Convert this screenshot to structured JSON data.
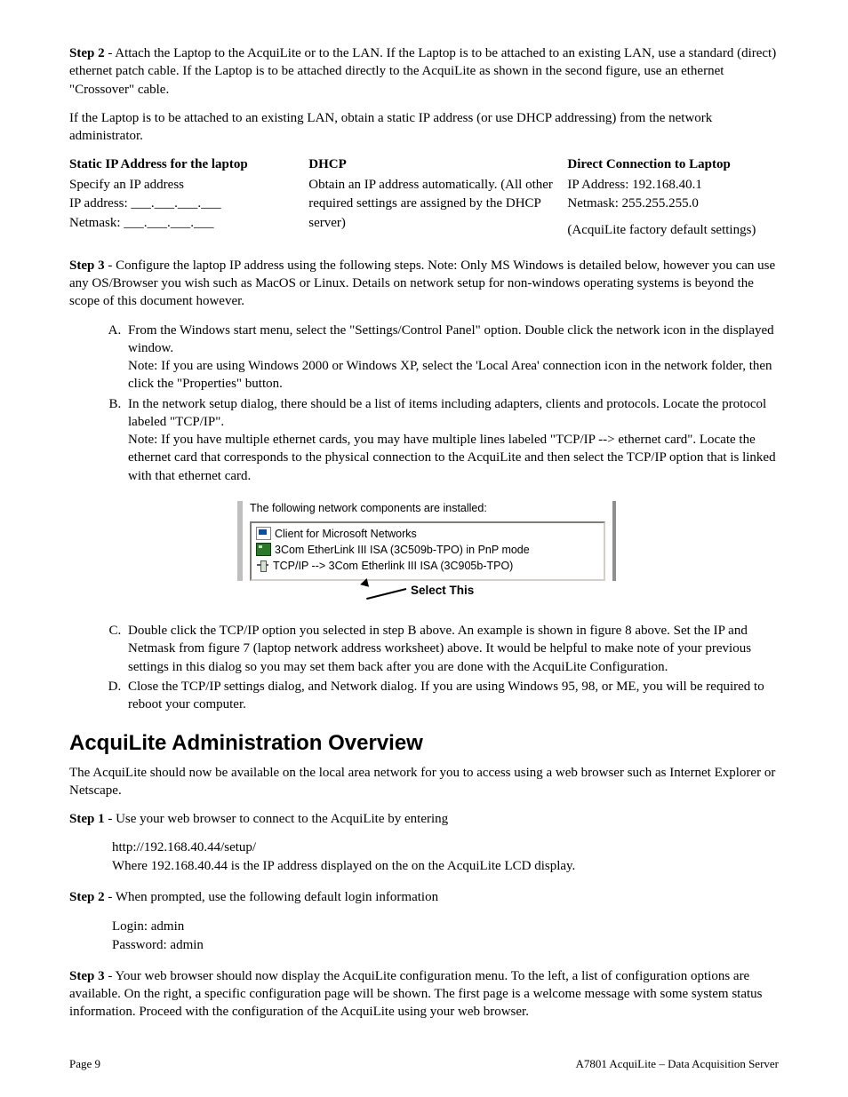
{
  "step2": {
    "label": "Step 2",
    "text1": " - Attach the Laptop to the AcquiLite or to the LAN. If the Laptop is to be attached to an existing LAN, use a standard (direct) ethernet patch cable. If the Laptop is to be attached directly to the AcquiLite as shown in the second figure, use an ethernet \"Crossover\" cable.",
    "text2": "If the Laptop is to be attached to an existing LAN, obtain a static IP address (or use DHCP addressing) from the network administrator."
  },
  "ipTable": {
    "col1": {
      "head": "Static IP Address for the laptop",
      "l1": "Specify an IP address",
      "l2": "IP address: ___.___.___.___",
      "l3": "Netmask: ___.___.___.___"
    },
    "col2": {
      "head": "DHCP",
      "l1": "Obtain an IP address automatically. (All other required settings are assigned by the DHCP server)"
    },
    "col3": {
      "head": "Direct Connection to Laptop",
      "l1": "IP Address: 192.168.40.1",
      "l2": "Netmask: 255.255.255.0",
      "l3": "(AcquiLite factory default settings)"
    }
  },
  "step3": {
    "label": "Step 3",
    "intro": " - Configure the laptop IP address using the following steps. Note: Only MS Windows is detailed below, however you can use any OS/Browser you wish such as MacOS or Linux. Details on network setup for non-windows operating systems is beyond the scope of this document however.",
    "A": "From the Windows start menu, select the \"Settings/Control Panel\" option. Double click the network icon in the displayed window.\nNote: If you are using Windows 2000 or Windows XP, select the 'Local Area' connection icon in the network folder, then click the \"Properties\" button.",
    "B": "In the network setup dialog, there should be a list of items including adapters, clients and protocols. Locate the protocol labeled \"TCP/IP\".\nNote: If you have multiple ethernet cards, you may have multiple lines labeled \"TCP/IP --> ethernet card\". Locate the ethernet card that corresponds to the physical connection to the AcquiLite and then select the TCP/IP option that is linked with that ethernet card.",
    "C": "Double click the TCP/IP option you selected in step B above. An example is shown in figure 8 above. Set the IP and Netmask from figure 7 (laptop network address worksheet) above. It would be helpful to make note of your previous settings in this dialog so you may set them back after you are done with the AcquiLite Configuration.",
    "D": "Close the TCP/IP settings dialog, and Network dialog. If you are using Windows 95, 98, or ME, you will be required to reboot your computer."
  },
  "dialog": {
    "caption": "The following network components are installed:",
    "item1": "Client for Microsoft Networks",
    "item2": "3Com EtherLink III ISA (3C509b-TPO) in PnP mode",
    "item3": "TCP/IP --> 3Com Etherlink III ISA (3C905b-TPO)",
    "selectThis": "Select This"
  },
  "adminHeading": "AcquiLite Administration Overview",
  "adminIntro": "The AcquiLite should now be available on the local area network for you to access using a web browser such as Internet Explorer or Netscape.",
  "aStep1": {
    "label": "Step 1",
    "text": " - Use your web browser to connect to the AcquiLite by entering",
    "url": "http://192.168.40.44/setup/",
    "note": "Where 192.168.40.44 is the IP address displayed on the on the AcquiLite LCD display."
  },
  "aStep2": {
    "label": "Step 2",
    "text": " - When prompted, use the following default login information",
    "login": "Login: admin",
    "password": "Password: admin"
  },
  "aStep3": {
    "label": "Step 3",
    "text": " - Your web browser should now display the AcquiLite configuration menu. To the left, a list of configuration options are available. On the right, a specific configuration page will be shown. The first page is a welcome message with some system status information. Proceed with the configuration of the AcquiLite using your web browser."
  },
  "footer": {
    "left": "Page 9",
    "right": "A7801 AcquiLite – Data Acquisition Server"
  }
}
